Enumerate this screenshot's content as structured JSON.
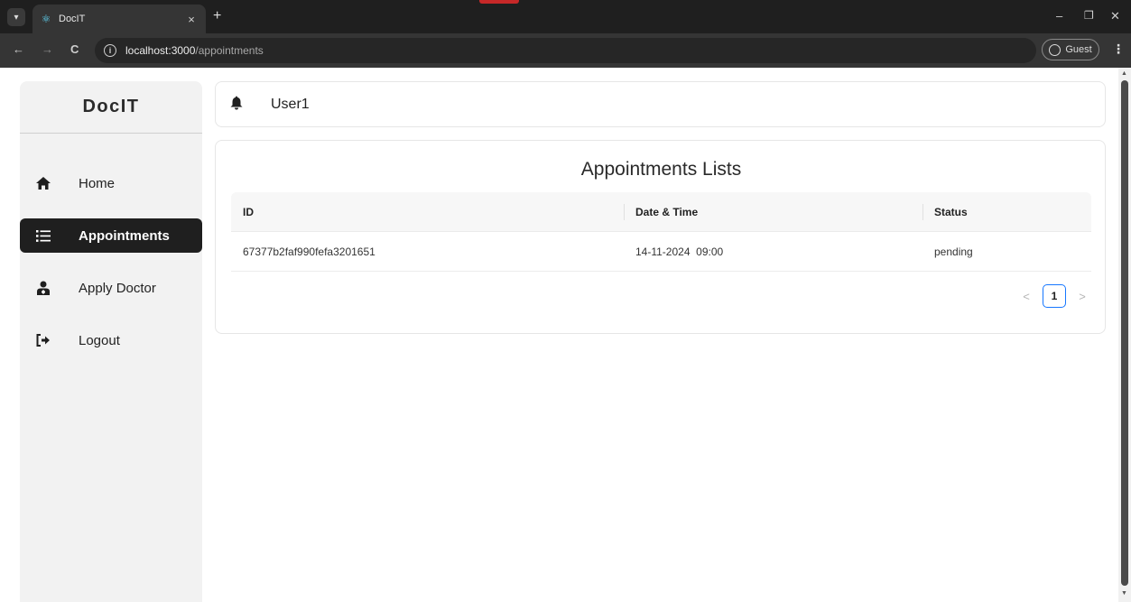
{
  "browser": {
    "tab_title": "DocIT",
    "tab_close": "×",
    "new_tab": "+",
    "url_host": "localhost:3000",
    "url_path": "/appointments",
    "guest_label": "Guest",
    "window_minimize": "–",
    "window_maximize": "❐",
    "window_close": "✕",
    "back": "←",
    "forward": "→",
    "reload": "C",
    "menu": "⋮"
  },
  "sidebar": {
    "brand": "DocIT",
    "items": [
      {
        "label": "Home",
        "icon": "home-icon",
        "active": false
      },
      {
        "label": "Appointments",
        "icon": "list-icon",
        "active": true
      },
      {
        "label": "Apply Doctor",
        "icon": "doctor-icon",
        "active": false
      },
      {
        "label": "Logout",
        "icon": "logout-icon",
        "active": false
      }
    ]
  },
  "header": {
    "username": "User1"
  },
  "main": {
    "title": "Appointments Lists",
    "columns": [
      "ID",
      "Date & Time",
      "Status"
    ],
    "rows": [
      {
        "id": "67377b2faf990fefa3201651",
        "datetime": "14-11-2024  09:00",
        "status": "pending"
      }
    ],
    "pagination": {
      "current": "1",
      "prev": "<",
      "next": ">"
    }
  },
  "colors": {
    "active_bg": "#1f1f1f",
    "pager_border": "#1677ff",
    "sidebar_bg": "#f2f2f2"
  }
}
